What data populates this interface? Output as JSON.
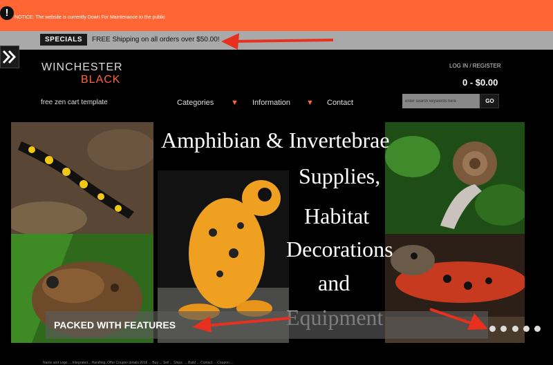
{
  "notice": {
    "icon": "exclamation-icon",
    "text": "NOTICE: The website is currently Down For Maintenance to the public"
  },
  "specials": {
    "badge": "SPECIALS",
    "shipping": "FREE Shipping on all orders over $50.00!"
  },
  "side_tab": {
    "icon": "double-chevron-right-icon",
    "glyph": "»"
  },
  "logo": {
    "line1": "WINCHESTER",
    "line2": "BLACK"
  },
  "tagline": "free zen cart template",
  "nav": {
    "categories": "Categories",
    "information": "Information",
    "contact": "Contact",
    "dropdown_glyph": "▼"
  },
  "account": {
    "login": "LOG IN / REGISTER",
    "cart_total": "0 - $0.00"
  },
  "search": {
    "placeholder": "enter search keywords here",
    "button": "GO"
  },
  "slider": {
    "heading_lines": [
      "Amphibian & Invertebrae",
      "Supplies,",
      "Habitat",
      "Decorations",
      "and",
      "Equipment"
    ],
    "caption": "PACKED WITH FEATURES",
    "dot_count": 5
  },
  "footer": {
    "text": "Name and Logo ... Integrated... Handling, Offer Coupon details 2016 ... Buy ... Sell ... Ships ..., Build ... Contact ... Coupon ..."
  },
  "colors": {
    "accent": "#ff6633",
    "annotation_arrow": "#e8301e"
  }
}
